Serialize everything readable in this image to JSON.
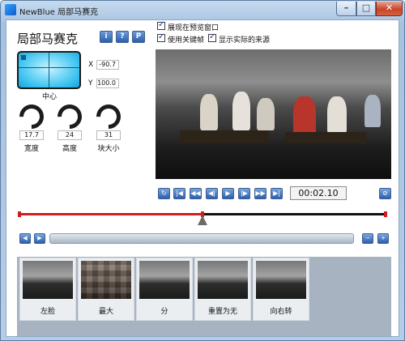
{
  "window": {
    "title": "NewBlue 局部马赛克",
    "min": "–",
    "max": "□",
    "close": "✕"
  },
  "effect": {
    "title": "局部马赛克",
    "buttons": [
      "i",
      "?",
      "P"
    ]
  },
  "pad": {
    "label": "中心"
  },
  "coords": {
    "x_label": "X",
    "x_value": "-90.7",
    "y_label": "Y",
    "y_value": "100.0"
  },
  "dials": [
    {
      "value": "17.7",
      "label": "宽度"
    },
    {
      "value": "24",
      "label": "高度"
    },
    {
      "value": "31",
      "label": "块大小"
    }
  ],
  "options": [
    {
      "label": "展现在预览窗口",
      "checked": true
    },
    {
      "label": "使用关键帧",
      "checked": true
    },
    {
      "label": "显示实际的来源",
      "checked": true
    }
  ],
  "transport": {
    "timecode": "00:02.10"
  },
  "presets": [
    {
      "label": "左脸"
    },
    {
      "label": "最大"
    },
    {
      "label": "分"
    },
    {
      "label": "重置为无"
    },
    {
      "label": "向右转"
    }
  ],
  "colors": {
    "accent": "#2c5fae",
    "keyframe": "#d11d1d"
  }
}
